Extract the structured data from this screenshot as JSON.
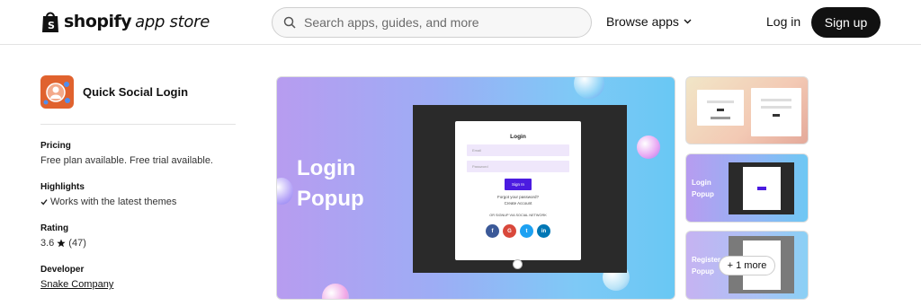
{
  "header": {
    "brand_bold": "shopify",
    "brand_rest": "app store",
    "search_placeholder": "Search apps, guides, and more",
    "browse_label": "Browse apps",
    "login_label": "Log in",
    "signup_label": "Sign up"
  },
  "app": {
    "name": "Quick Social Login",
    "pricing_label": "Pricing",
    "pricing_value": "Free plan available. Free trial available.",
    "highlights_label": "Highlights",
    "highlights_value": "Works with the latest themes",
    "rating_label": "Rating",
    "rating_value": "3.6",
    "rating_count": "(47)",
    "developer_label": "Developer",
    "developer_value": "Snake Company"
  },
  "gallery": {
    "hero_title_line1": "Login",
    "hero_title_line2": "Popup",
    "modal_title": "Login",
    "modal_email": "Email",
    "modal_password": "Password",
    "modal_button": "Sign In",
    "modal_forgot": "Forgot your password?",
    "modal_create": "Create Account",
    "modal_or": "OR SIGNUP VIA SOCIAL NETWORK",
    "thumb2_line1": "Login",
    "thumb2_line2": "Popup",
    "thumb3_line1": "Register",
    "thumb3_line2": "Popup",
    "more_label": "+ 1 more"
  },
  "colors": {
    "accent_button": "#111111",
    "app_icon": "#e0622e",
    "signin_button": "#4b1be0"
  }
}
